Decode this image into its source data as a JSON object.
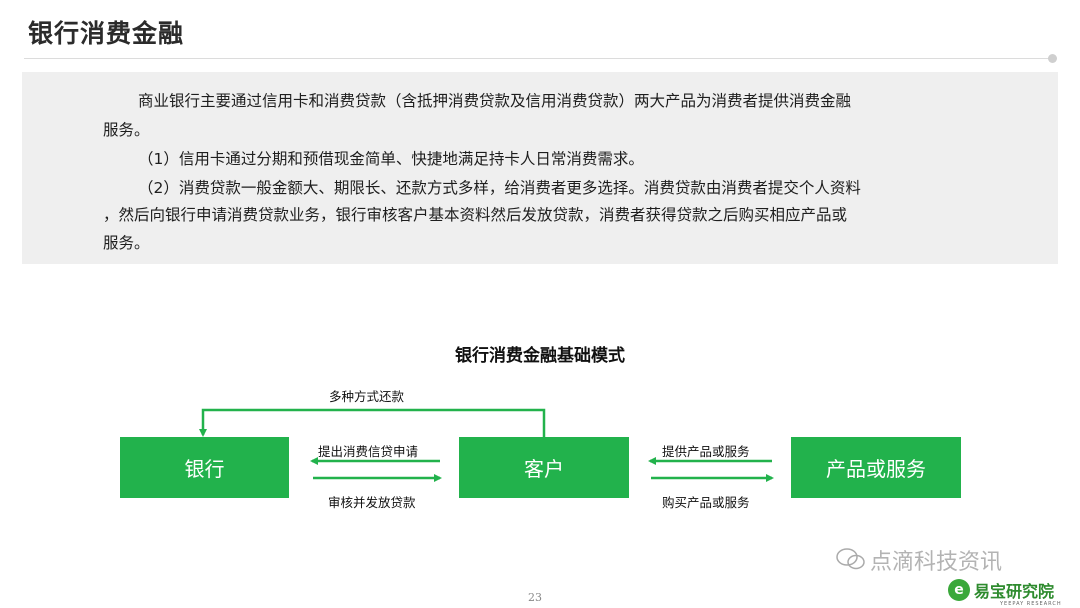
{
  "header": {
    "title": "银行消费金融"
  },
  "intro": {
    "line1": "商业银行主要通过信用卡和消费贷款（含抵押消费贷款及信用消费贷款）两大产品为消费者提供消费金融",
    "line2": "服务。",
    "line3": "（1）信用卡通过分期和预借现金简单、快捷地满足持卡人日常消费需求。",
    "line4": "（2）消费贷款一般金额大、期限长、还款方式多样，给消费者更多选择。消费贷款由消费者提交个人资料",
    "line5": "，然后向银行申请消费贷款业务，银行审核客户基本资料然后发放贷款，消费者获得贷款之后购买相应产品或",
    "line6": "服务。"
  },
  "diagram": {
    "title": "银行消费金融基础模式",
    "nodes": {
      "bank": "银行",
      "customer": "客户",
      "product": "产品或服务"
    },
    "edges": {
      "repay": "多种方式还款",
      "apply": "提出消费信贷申请",
      "approve": "审核并发放贷款",
      "provide": "提供产品或服务",
      "purchase": "购买产品或服务"
    },
    "accent_color": "#22b24c"
  },
  "footer": {
    "page_number": "23",
    "watermark": "点滴科技资讯",
    "logo_text": "易宝研究院",
    "logo_sub": "YEEPAY RESEARCH",
    "logo_mark": "e"
  }
}
